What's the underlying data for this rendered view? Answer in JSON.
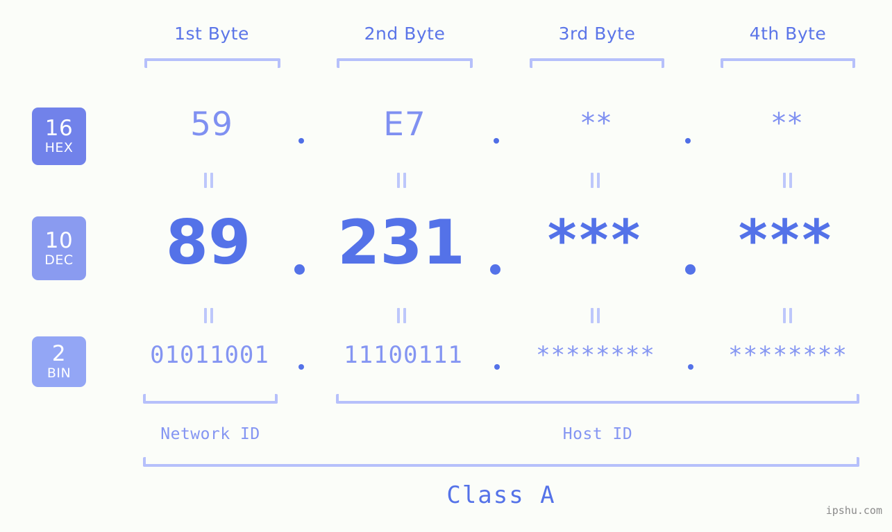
{
  "diagram": {
    "title_watermark": "ipshu.com",
    "accent_strong": "#5472e8",
    "accent_mid": "#7f90f1",
    "accent_light": "#b6c0fb",
    "background": "#fbfdf9"
  },
  "byte_headers": [
    {
      "label": "1st Byte"
    },
    {
      "label": "2nd Byte"
    },
    {
      "label": "3rd Byte"
    },
    {
      "label": "4th Byte"
    }
  ],
  "bases": [
    {
      "number": "16",
      "name": "HEX",
      "color": "#7182ea"
    },
    {
      "number": "10",
      "name": "DEC",
      "color": "#8a9bf0"
    },
    {
      "number": "2",
      "name": "BIN",
      "color": "#93a6f5"
    }
  ],
  "rows": {
    "hex": {
      "base_number": "16",
      "base_name": "HEX",
      "values": [
        "59",
        "E7",
        "**",
        "**"
      ],
      "separators": [
        ".",
        ".",
        "."
      ]
    },
    "dec": {
      "base_number": "10",
      "base_name": "DEC",
      "values": [
        "89",
        "231",
        "***",
        "***"
      ],
      "separators": [
        ".",
        ".",
        "."
      ]
    },
    "bin": {
      "base_number": "2",
      "base_name": "BIN",
      "values": [
        "01011001",
        "11100111",
        "********",
        "********"
      ],
      "separators": [
        ".",
        ".",
        "."
      ]
    }
  },
  "equals_marks": {
    "symbol": "=",
    "count_per_row_gap": 4
  },
  "regions": [
    {
      "label": "Network ID"
    },
    {
      "label": "Host ID"
    }
  ],
  "class": {
    "label": "Class A"
  }
}
